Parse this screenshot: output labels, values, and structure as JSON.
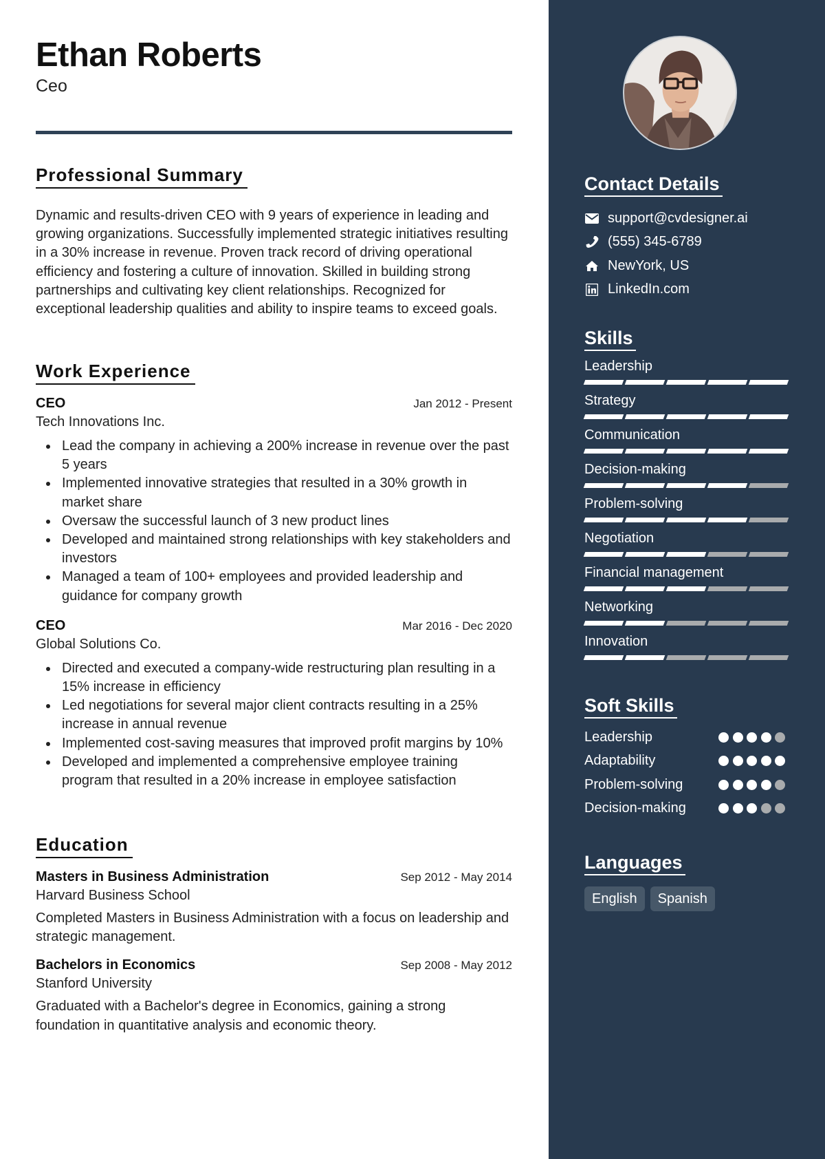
{
  "header": {
    "name": "Ethan Roberts",
    "title": "Ceo"
  },
  "summary": {
    "heading": "Professional Summary",
    "text": "Dynamic and results-driven CEO with 9 years of experience in leading and growing organizations. Successfully implemented strategic initiatives resulting in a 30% increase in revenue. Proven track record of driving operational efficiency and fostering a culture of innovation. Skilled in building strong partnerships and cultivating key client relationships. Recognized for exceptional leadership qualities and ability to inspire teams to exceed goals."
  },
  "work": {
    "heading": "Work Experience",
    "jobs": [
      {
        "title": "CEO",
        "dates": "Jan 2012 - Present",
        "company": "Tech Innovations Inc.",
        "bullets": [
          "Lead the company in achieving a 200% increase in revenue over the past 5 years",
          "Implemented innovative strategies that resulted in a 30% growth in market share",
          "Oversaw the successful launch of 3 new product lines",
          "Developed and maintained strong relationships with key stakeholders and investors",
          "Managed a team of 100+ employees and provided leadership and guidance for company growth"
        ]
      },
      {
        "title": "CEO",
        "dates": "Mar 2016 - Dec 2020",
        "company": "Global Solutions Co.",
        "bullets": [
          "Directed and executed a company-wide restructuring plan resulting in a 15% increase in efficiency",
          "Led negotiations for several major client contracts resulting in a 25% increase in annual revenue",
          "Implemented cost-saving measures that improved profit margins by 10%",
          "Developed and implemented a comprehensive employee training program that resulted in a 20% increase in employee satisfaction"
        ]
      }
    ]
  },
  "education": {
    "heading": "Education",
    "items": [
      {
        "degree": "Masters in Business Administration",
        "dates": "Sep 2012 - May 2014",
        "school": "Harvard Business School",
        "description": "Completed Masters in Business Administration with a focus on leadership and strategic management."
      },
      {
        "degree": "Bachelors in Economics",
        "dates": "Sep 2008 - May 2012",
        "school": "Stanford University",
        "description": "Graduated with a Bachelor's degree in Economics, gaining a strong foundation in quantitative analysis and economic theory."
      }
    ]
  },
  "sidebar": {
    "photo_alt": "profile-photo",
    "contact": {
      "heading": "Contact Details",
      "items": [
        {
          "icon": "envelope-icon",
          "text": "support@cvdesigner.ai"
        },
        {
          "icon": "phone-icon",
          "text": "(555) 345-6789"
        },
        {
          "icon": "home-icon",
          "text": "NewYork, US"
        },
        {
          "icon": "linkedin-icon",
          "text": "LinkedIn.com"
        }
      ]
    },
    "skills": {
      "heading": "Skills",
      "max": 5,
      "items": [
        {
          "name": "Leadership",
          "level": 5
        },
        {
          "name": "Strategy",
          "level": 5
        },
        {
          "name": "Communication",
          "level": 5
        },
        {
          "name": "Decision-making",
          "level": 4
        },
        {
          "name": "Problem-solving",
          "level": 4
        },
        {
          "name": "Negotiation",
          "level": 3
        },
        {
          "name": "Financial management",
          "level": 3
        },
        {
          "name": "Networking",
          "level": 2
        },
        {
          "name": "Innovation",
          "level": 2
        }
      ]
    },
    "soft_skills": {
      "heading": "Soft Skills",
      "max": 5,
      "items": [
        {
          "name": "Leadership",
          "level": 4
        },
        {
          "name": "Adaptability",
          "level": 5
        },
        {
          "name": "Problem-solving",
          "level": 4
        },
        {
          "name": "Decision-making",
          "level": 3
        }
      ]
    },
    "languages": {
      "heading": "Languages",
      "items": [
        "English",
        "Spanish"
      ]
    }
  },
  "colors": {
    "sidebar_bg": "#283a4f",
    "accent_rule": "#2f4256",
    "level_on": "#ffffff",
    "level_off": "#a9abad",
    "chip_bg": "#475869"
  }
}
